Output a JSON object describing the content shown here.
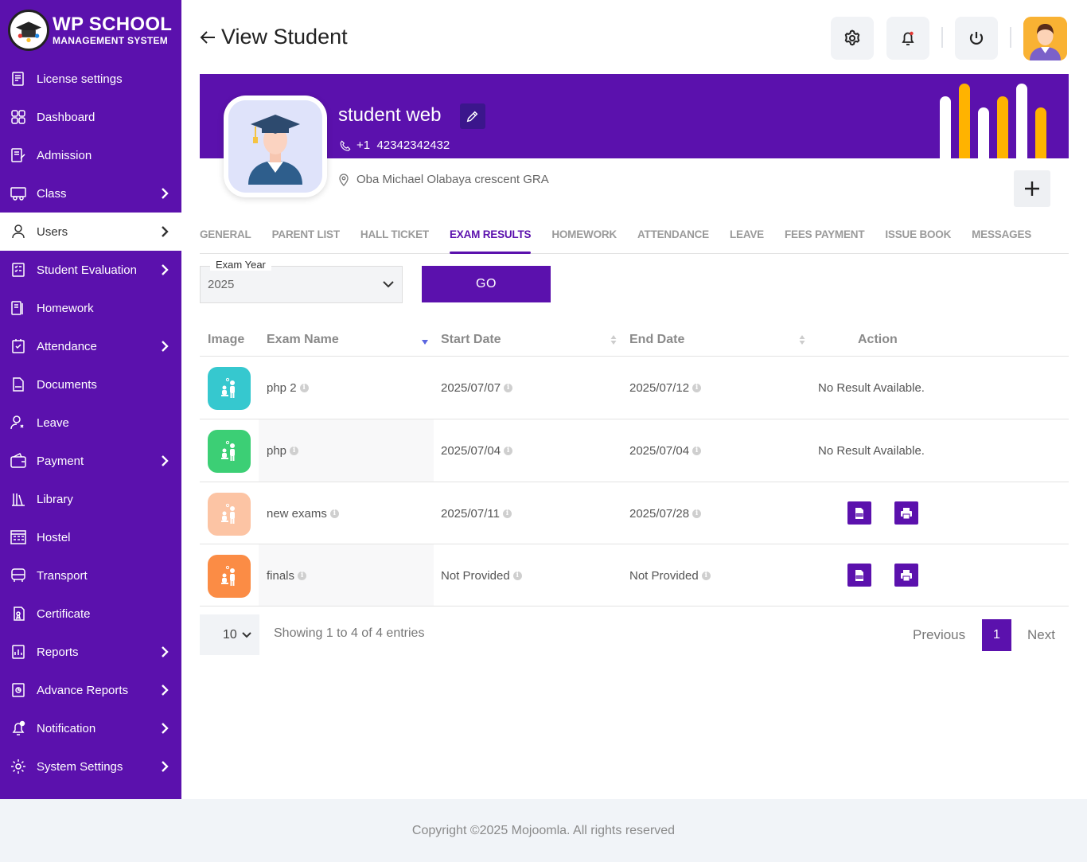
{
  "brand": {
    "title": "WP SCHOOL",
    "subtitle": "MANAGEMENT SYSTEM"
  },
  "sidebar": {
    "items": [
      {
        "label": "License settings",
        "icon": "license-icon",
        "chevron": false
      },
      {
        "label": "Dashboard",
        "icon": "dashboard-icon",
        "chevron": false
      },
      {
        "label": "Admission",
        "icon": "admission-icon",
        "chevron": false
      },
      {
        "label": "Class",
        "icon": "class-icon",
        "chevron": true
      },
      {
        "label": "Users",
        "icon": "user-icon",
        "chevron": true,
        "active": true
      },
      {
        "label": "Student Evaluation",
        "icon": "evaluation-icon",
        "chevron": true
      },
      {
        "label": "Homework",
        "icon": "homework-icon",
        "chevron": false
      },
      {
        "label": "Attendance",
        "icon": "attendance-icon",
        "chevron": true
      },
      {
        "label": "Documents",
        "icon": "documents-icon",
        "chevron": false
      },
      {
        "label": "Leave",
        "icon": "leave-icon",
        "chevron": false
      },
      {
        "label": "Payment",
        "icon": "payment-icon",
        "chevron": true
      },
      {
        "label": "Library",
        "icon": "library-icon",
        "chevron": false
      },
      {
        "label": "Hostel",
        "icon": "hostel-icon",
        "chevron": false
      },
      {
        "label": "Transport",
        "icon": "transport-icon",
        "chevron": false
      },
      {
        "label": "Certificate",
        "icon": "certificate-icon",
        "chevron": false
      },
      {
        "label": "Reports",
        "icon": "reports-icon",
        "chevron": true
      },
      {
        "label": "Advance Reports",
        "icon": "advance-reports-icon",
        "chevron": true
      },
      {
        "label": "Notification",
        "icon": "notification-icon",
        "chevron": true
      },
      {
        "label": "System Settings",
        "icon": "settings-icon",
        "chevron": true
      }
    ]
  },
  "header": {
    "title": "View Student"
  },
  "profile": {
    "name": "student web",
    "phone_code": "+1",
    "phone": "42342342432",
    "address": "Oba Michael Olabaya crescent GRA"
  },
  "tabs": [
    "GENERAL",
    "PARENT LIST",
    "HALL TICKET",
    "EXAM RESULTS",
    "HOMEWORK",
    "ATTENDANCE",
    "LEAVE",
    "FEES PAYMENT",
    "ISSUE BOOK",
    "MESSAGES"
  ],
  "active_tab": "EXAM RESULTS",
  "filter": {
    "label": "Exam Year",
    "value": "2025",
    "go_label": "GO"
  },
  "table": {
    "columns": [
      "Image",
      "Exam Name",
      "Start Date",
      "End Date",
      "Action"
    ],
    "rows": [
      {
        "name": "php 2",
        "start": "2025/07/07",
        "end": "2025/07/12",
        "action": "No Result Available.",
        "color": "#36c8cf"
      },
      {
        "name": "php",
        "start": "2025/07/04",
        "end": "2025/07/04",
        "action": "No Result Available.",
        "color": "#3ccf75"
      },
      {
        "name": "new exams",
        "start": "2025/07/11",
        "end": "2025/07/28",
        "action": "",
        "color": "#fcc4a4"
      },
      {
        "name": "finals",
        "start": "Not Provided",
        "end": "Not Provided",
        "action": "",
        "color": "#fb8c45"
      }
    ],
    "page_length": "10",
    "info": "Showing 1 to 4 of 4 entries",
    "prev_label": "Previous",
    "current_page": "1",
    "next_label": "Next"
  },
  "footer": {
    "copyright": "Copyright ©2025 Mojoomla. All rights reserved"
  },
  "colors": {
    "primary": "#5b11ad",
    "accent_bar": "#ffb300"
  }
}
